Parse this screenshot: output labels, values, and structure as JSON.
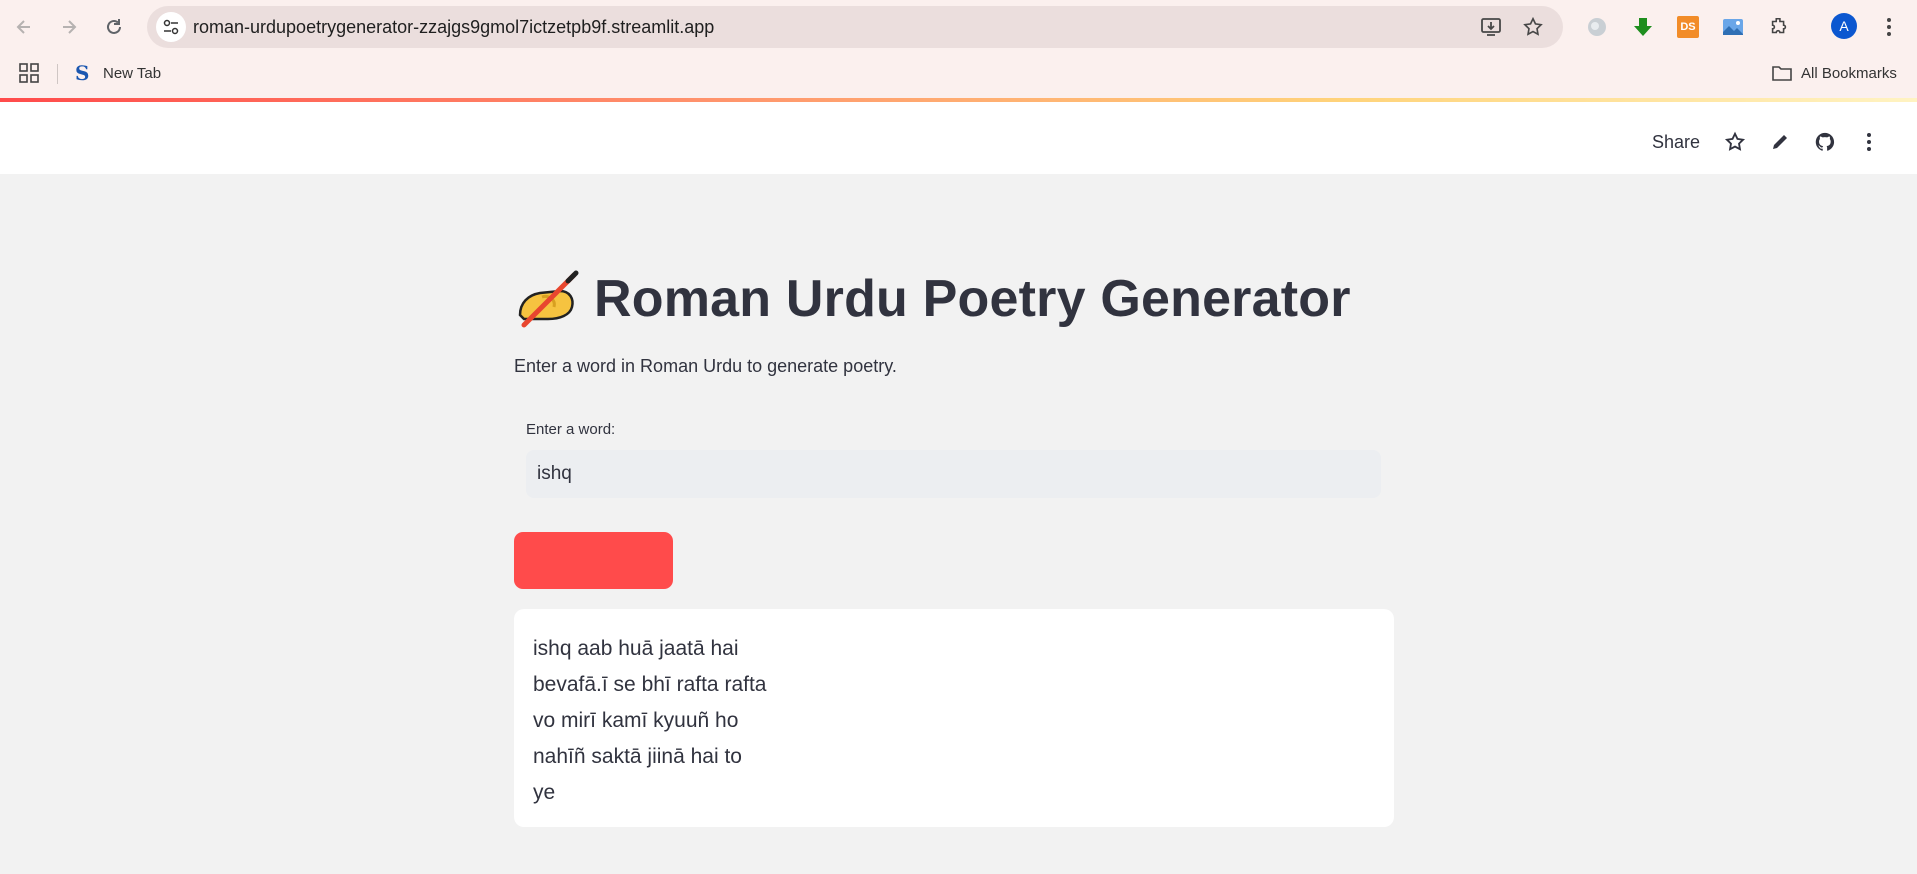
{
  "browser": {
    "url": "roman-urdupoetrygenerator-zzajgs9gmol7ictzetpb9f.streamlit.app",
    "ext_ds_label": "DS",
    "avatar_letter": "A",
    "bookmarks": {
      "new_tab_label": "New Tab",
      "s_logo": "S",
      "all_bookmarks_label": "All Bookmarks"
    }
  },
  "header": {
    "share_label": "Share"
  },
  "main": {
    "title_emoji": "✍️",
    "title": "Roman Urdu Poetry Generator",
    "description": "Enter a word in Roman Urdu to generate poetry.",
    "input_label": "Enter a word:",
    "input_value": "ishq",
    "button_label": "",
    "poem_lines": [
      "ishq aab huā jaatā hai",
      "bevafā.ī se bhī rafta rafta",
      "vo mirī kamī kyuuñ ho",
      "nahīñ saktā jiinā hai to",
      "ye"
    ]
  },
  "colors": {
    "accent": "#ff4b4b",
    "text": "#31333f",
    "page_bg": "#f2f2f2"
  }
}
